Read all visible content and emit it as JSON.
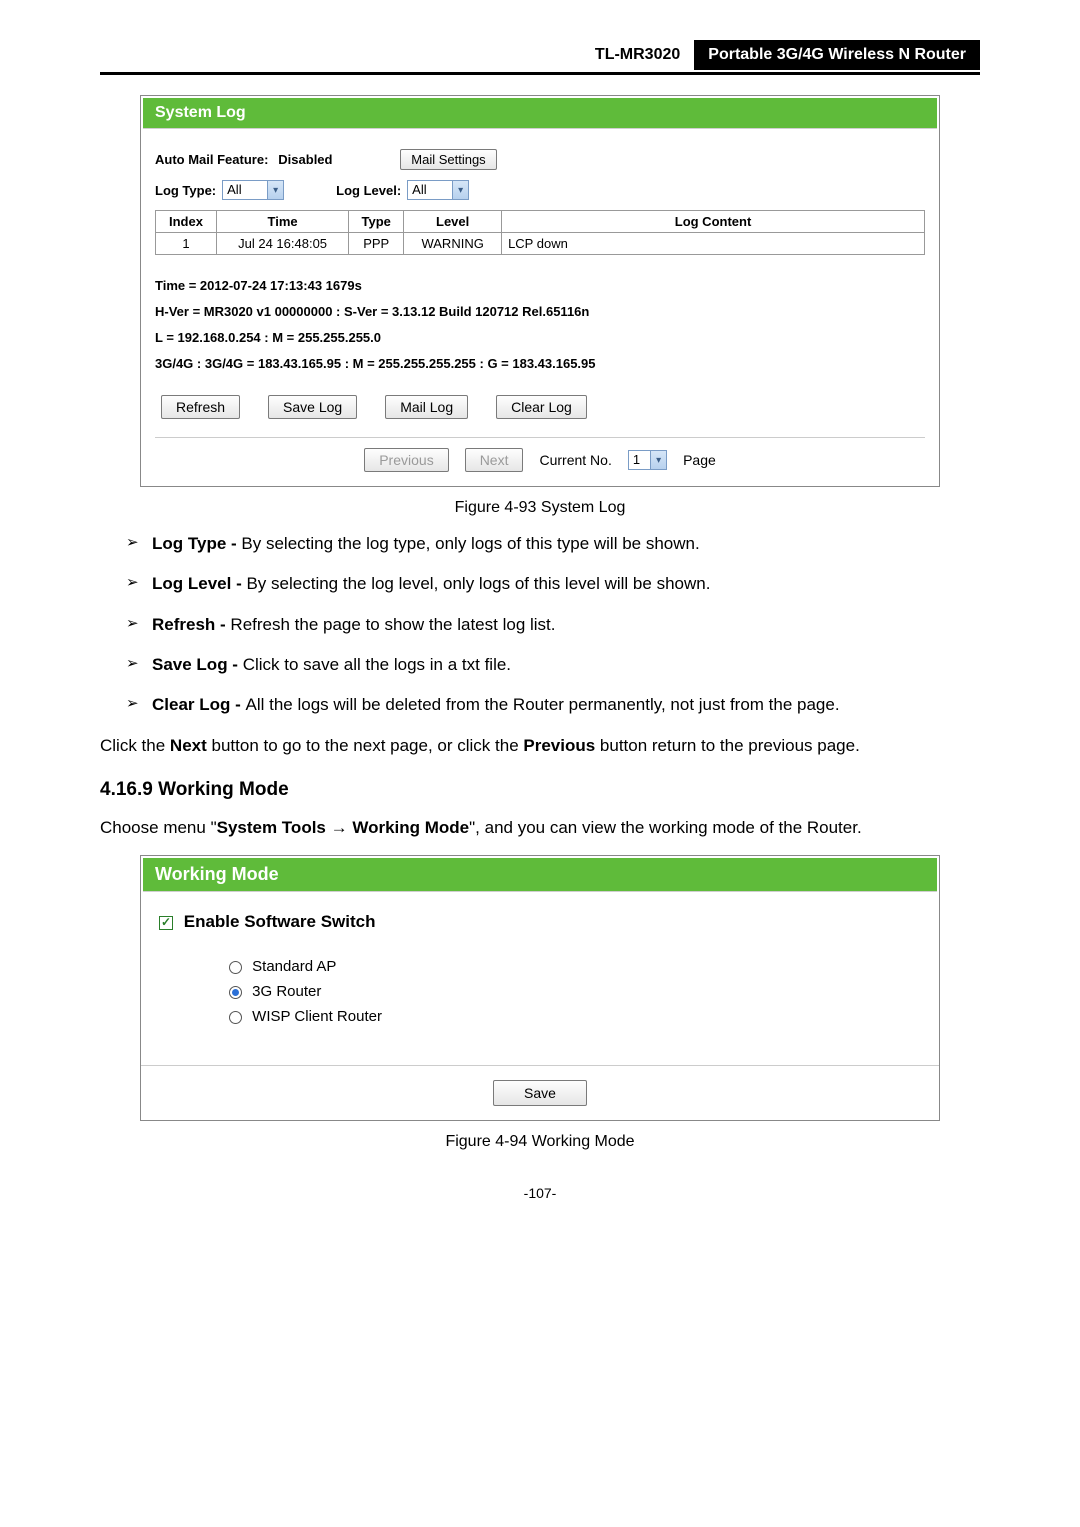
{
  "header": {
    "model": "TL-MR3020",
    "title": "Portable 3G/4G Wireless N Router"
  },
  "fig1": {
    "panel_title": "System Log",
    "auto_mail_label": "Auto Mail Feature:",
    "auto_mail_value": "Disabled",
    "mail_settings_btn": "Mail Settings",
    "log_type_label": "Log Type:",
    "log_type_value": "All",
    "log_level_label": "Log Level:",
    "log_level_value": "All",
    "th_index": "Index",
    "th_time": "Time",
    "th_type": "Type",
    "th_level": "Level",
    "th_content": "Log Content",
    "row1_index": "1",
    "row1_time": "Jul 24 16:48:05",
    "row1_type": "PPP",
    "row1_level": "WARNING",
    "row1_content": "LCP down",
    "info_time": "Time = 2012-07-24 17:13:43 1679s",
    "info_hver": "H-Ver = MR3020 v1 00000000 : S-Ver = 3.13.12 Build 120712 Rel.65116n",
    "info_lm": "L = 192.168.0.254 : M = 255.255.255.0",
    "info_3g": "3G/4G : 3G/4G = 183.43.165.95 : M = 255.255.255.255 : G = 183.43.165.95",
    "refresh": "Refresh",
    "save_log": "Save Log",
    "mail_log": "Mail Log",
    "clear_log": "Clear Log",
    "previous": "Previous",
    "next": "Next",
    "current_no_label": "Current No.",
    "current_no_value": "1",
    "page_label": "Page",
    "caption": "Figure 4-93   System Log"
  },
  "bullets": {
    "b1_term": "Log Type - ",
    "b1_text": "By selecting the log type, only logs of this type will be shown.",
    "b2_term": "Log Level - ",
    "b2_text": "By selecting the log level, only logs of this level will be shown.",
    "b3_term": "Refresh - ",
    "b3_text": "Refresh the page to show the latest log list.",
    "b4_term": "Save Log - ",
    "b4_text": "Click to save all the logs in a txt file.",
    "b5_term": "Clear Log - ",
    "b5_text": "All the logs will be deleted from the Router permanently, not just from the page."
  },
  "para": {
    "p1a": "Click the ",
    "p1_next": "Next",
    "p1b": " button to go to the next page, or click the ",
    "p1_prev": "Previous",
    "p1c": " button return to the previous page."
  },
  "section": {
    "num_title": "4.16.9  Working Mode",
    "p2a": "Choose menu \"",
    "p2_sys": "System Tools",
    "p2_arrow": " → ",
    "p2_wm": "Working Mode",
    "p2b": "\", and you can view the working mode of the Router."
  },
  "fig2": {
    "panel_title": "Working Mode",
    "chk_label": "Enable Software Switch",
    "opt1": "Standard AP",
    "opt2": "3G Router",
    "opt3": "WISP Client Router",
    "save": "Save",
    "caption": "Figure 4-94   Working Mode"
  },
  "footer_page": "-107-"
}
